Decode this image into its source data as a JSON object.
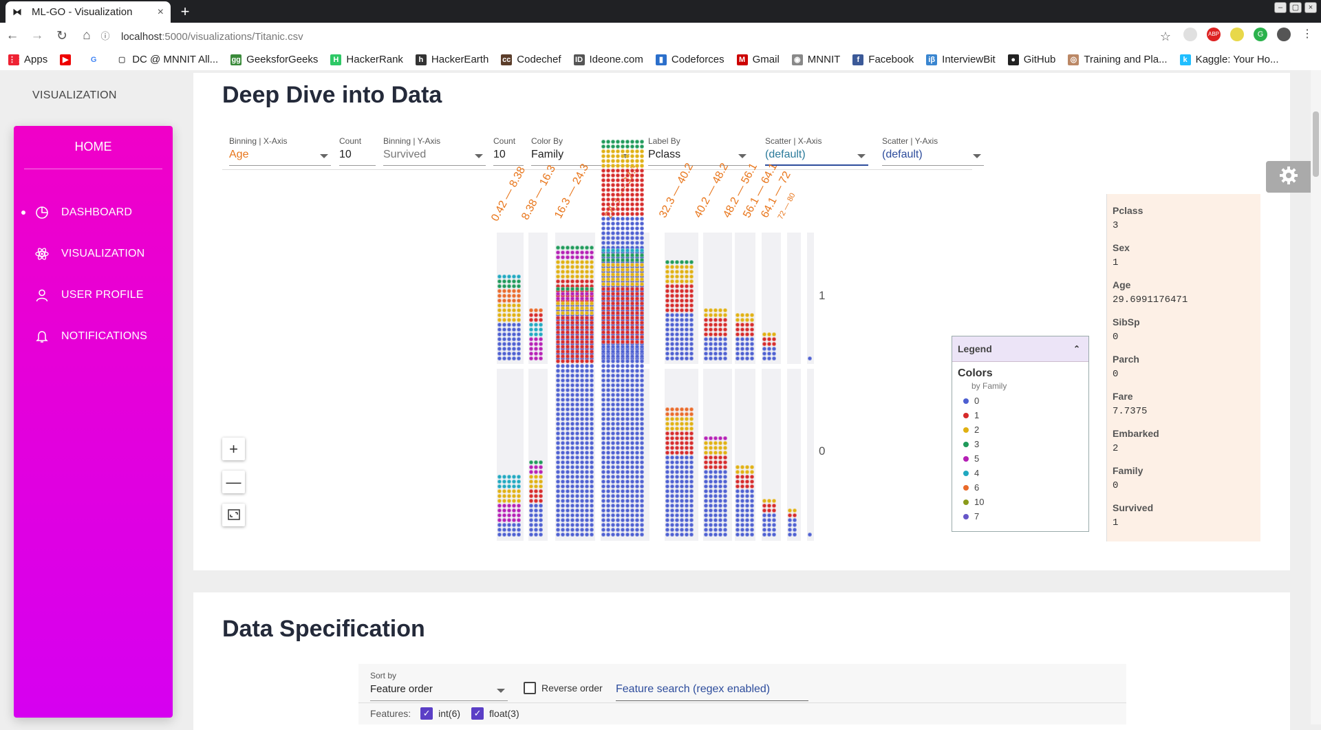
{
  "browser": {
    "tab_title": "ML-GO - Visualization",
    "url_host": "localhost",
    "url_path": ":5000/visualizations/Titanic.csv",
    "bookmarks": [
      "Apps",
      "",
      "",
      "DC @ MNNIT All...",
      "GeeksforGeeks",
      "HackerRank",
      "HackerEarth",
      "Codechef",
      "Ideone.com",
      "Codeforces",
      "Gmail",
      "MNNIT",
      "Facebook",
      "InterviewBit",
      "GitHub",
      "Training and Pla...",
      "Kaggle: Your Ho..."
    ]
  },
  "sidebar": {
    "title": "VISUALIZATION",
    "home": "HOME",
    "items": [
      {
        "label": "DASHBOARD",
        "icon": "pie-chart-icon",
        "active": true
      },
      {
        "label": "VISUALIZATION",
        "icon": "atom-icon",
        "active": false
      },
      {
        "label": "USER PROFILE",
        "icon": "person-icon",
        "active": false
      },
      {
        "label": "NOTIFICATIONS",
        "icon": "bell-icon",
        "active": false
      }
    ]
  },
  "main": {
    "title": "Deep Dive into Data",
    "controls": {
      "binx": {
        "label": "Binning | X-Axis",
        "value": "Age"
      },
      "countx": {
        "label": "Count",
        "value": "10"
      },
      "biny": {
        "label": "Binning | Y-Axis",
        "value": "Survived"
      },
      "county": {
        "label": "Count",
        "value": "10"
      },
      "color": {
        "label": "Color By",
        "value": "Family"
      },
      "labelby": {
        "label": "Label By",
        "value": "Pclass"
      },
      "scatterx": {
        "label": "Scatter | X-Axis",
        "value": "(default)"
      },
      "scattery": {
        "label": "Scatter | Y-Axis",
        "value": "(default)"
      }
    },
    "zoom": {
      "in": "+",
      "out": "—"
    }
  },
  "chart_data": {
    "type": "facets-dive",
    "x_bins": [
      "0.42 — 8.38",
      "8.38 — 16.3",
      "16.3 — 24.3",
      "24.3 — 32.3",
      "32.3 — 40.2",
      "40.2 — 48.2",
      "48.2 — 56.1",
      "56.1 — 64.1",
      "64.1 — 72",
      "72 — 80"
    ],
    "y_bins": [
      "1",
      "0"
    ],
    "colors": [
      "#4d5fd1",
      "#d62a2a",
      "#e0b012",
      "#1f9a5a",
      "#b51fb5",
      "#20a8c0",
      "#e96a2a",
      "#8a9a1a",
      "#6656c8"
    ]
  },
  "legend": {
    "title": "Legend",
    "section": "Colors",
    "subtitle": "by Family",
    "items": [
      {
        "label": "0",
        "color": "#4d5fd1"
      },
      {
        "label": "1",
        "color": "#d62a2a"
      },
      {
        "label": "2",
        "color": "#e0b012"
      },
      {
        "label": "3",
        "color": "#1f9a5a"
      },
      {
        "label": "5",
        "color": "#b51fb5"
      },
      {
        "label": "4",
        "color": "#20a8c0"
      },
      {
        "label": "6",
        "color": "#e96a2a"
      },
      {
        "label": "10",
        "color": "#8a9a1a"
      },
      {
        "label": "7",
        "color": "#6656c8"
      }
    ]
  },
  "info": [
    {
      "key": "Pclass",
      "value": "3"
    },
    {
      "key": "Sex",
      "value": "1"
    },
    {
      "key": "Age",
      "value": "29.6991176471"
    },
    {
      "key": "SibSp",
      "value": "0"
    },
    {
      "key": "Parch",
      "value": "0"
    },
    {
      "key": "Fare",
      "value": "7.7375"
    },
    {
      "key": "Embarked",
      "value": "2"
    },
    {
      "key": "Family",
      "value": "0"
    },
    {
      "key": "Survived",
      "value": "1"
    }
  ],
  "spec": {
    "title": "Data Specification",
    "sort_label": "Sort by",
    "sort_value": "Feature order",
    "reverse": "Reverse order",
    "search_placeholder": "Feature search (regex enabled)",
    "features_label": "Features:",
    "int_label": "int(6)",
    "float_label": "float(3)"
  }
}
